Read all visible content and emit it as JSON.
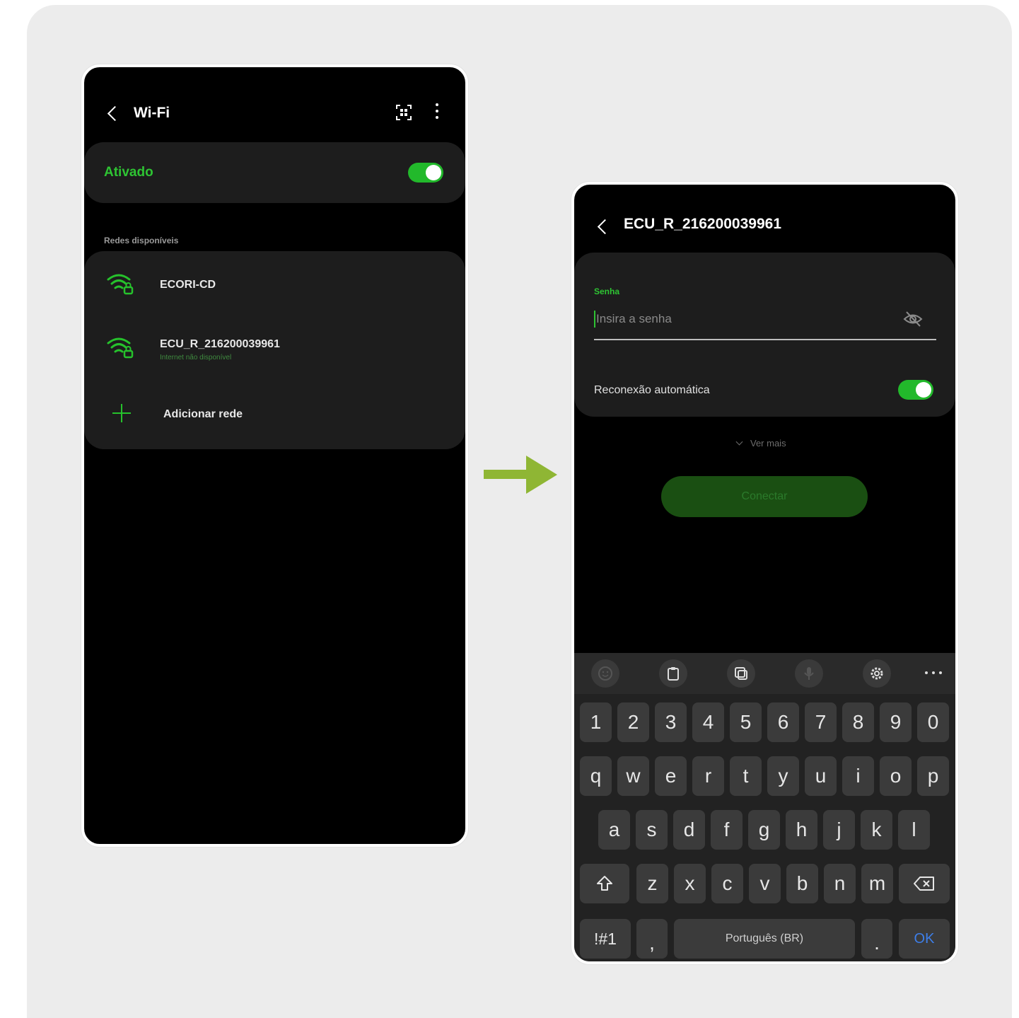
{
  "screen1": {
    "title": "Wi-Fi",
    "toggle_label": "Ativado",
    "toggle_on": true,
    "section_label": "Redes disponíveis",
    "networks": [
      {
        "name": "ECORI-CD",
        "status": ""
      },
      {
        "name": "ECU_R_216200039961",
        "status": "Internet não disponível"
      }
    ],
    "add_network_label": "Adicionar rede",
    "icons": [
      "back-arrow-icon",
      "qr-scan-icon",
      "more-vert-icon",
      "wifi-lock-icon",
      "plus-icon"
    ]
  },
  "screen2": {
    "title": "ECU_R_216200039961",
    "password_label": "Senha",
    "password_placeholder": "Insira a senha",
    "auto_reconnect_label": "Reconexão automática",
    "auto_reconnect_on": true,
    "see_more_label": "Ver mais",
    "connect_label": "Conectar",
    "icons": [
      "back-arrow-icon",
      "eye-off-icon",
      "chevron-down-icon"
    ]
  },
  "keyboard": {
    "toolbar": [
      "emoji-icon",
      "clipboard-icon",
      "sticker-icon",
      "mic-icon",
      "settings-icon",
      "more-horiz-icon"
    ],
    "number_row": [
      "1",
      "2",
      "3",
      "4",
      "5",
      "6",
      "7",
      "8",
      "9",
      "0"
    ],
    "row1": [
      "q",
      "w",
      "e",
      "r",
      "t",
      "y",
      "u",
      "i",
      "o",
      "p"
    ],
    "row2": [
      "a",
      "s",
      "d",
      "f",
      "g",
      "h",
      "j",
      "k",
      "l"
    ],
    "row3": [
      "z",
      "x",
      "c",
      "v",
      "b",
      "n",
      "m"
    ],
    "symbols_label": "!#1",
    "comma": ",",
    "space_label": "Português (BR)",
    "period": ".",
    "ok_label": "OK"
  },
  "colors": {
    "accent_green": "#22b92b",
    "arrow_green": "#8fb634",
    "background": "#ececec"
  }
}
